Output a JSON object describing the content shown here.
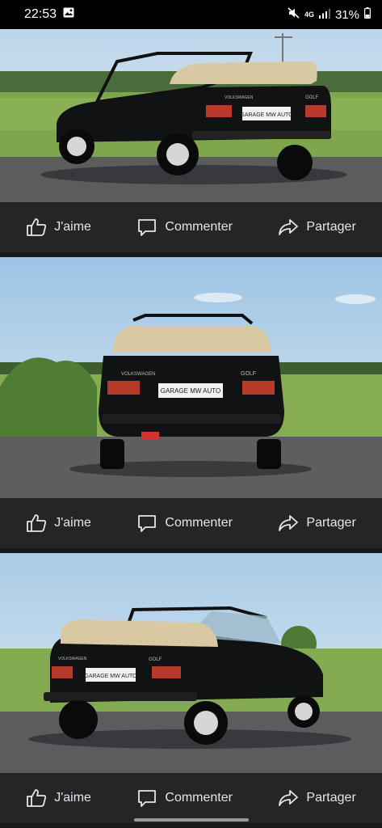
{
  "status": {
    "time": "22:53",
    "network": "4G",
    "battery": "31%"
  },
  "posts": [
    {
      "like": "J'aime",
      "comment": "Commenter",
      "share": "Partager",
      "plate": "GARAGE MW AUTO",
      "badge": "GOLF",
      "brand": "VOLKSWAGEN"
    },
    {
      "like": "J'aime",
      "comment": "Commenter",
      "share": "Partager",
      "plate": "GARAGE MW AUTO",
      "badge": "GOLF",
      "brand": "VOLKSWAGEN"
    },
    {
      "like": "J'aime",
      "comment": "Commenter",
      "share": "Partager",
      "plate": "GARAGE MW AUTO",
      "badge": "GOLF",
      "brand": "VOLKSWAGEN"
    }
  ],
  "colors": {
    "bar": "#242526",
    "bg": "#18191a",
    "text": "#e4e6eb",
    "car": "#111214",
    "roof": "#d9c9a3"
  },
  "icons": {
    "like": "thumbs-up-icon",
    "comment": "comment-bubble-icon",
    "share": "share-arrow-icon"
  }
}
